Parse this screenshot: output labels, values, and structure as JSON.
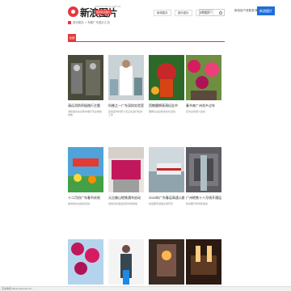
{
  "header": {
    "logo_text": "新浪图片",
    "logo_sub": "PHOTO.SINA.COM.CN",
    "logo_badge": "国家新闻图片"
  },
  "nav": [
    "新闻图片",
    "娱乐图片",
    "体育图片"
  ],
  "search": {
    "placeholder": "搜索图片"
  },
  "login": {
    "text": "新浪用户请登录/体验",
    "button": "新浪图片"
  },
  "breadcrumb": {
    "home": "首页",
    "path": "首页图片 > 专题广东图片汇总"
  },
  "tabs": {
    "active": "全部"
  },
  "cards": [
    {
      "title": "清远消防积极践行主题",
      "desc": "消防官兵在演练中展示专业救援技能"
    },
    {
      "title": "科普之一广东深圳实验室",
      "desc": "实验室内科研人员正在进行检测工作"
    },
    {
      "title": "西樵醒狮表演纪念节",
      "desc": "醒狮表演迎新春文化活动"
    },
    {
      "title": "春节来广州花乡过年",
      "desc": "花市迎春游人如织"
    },
    {
      "title": "十二月份广东春节庆祝",
      "desc": "各地举办迎新春活动"
    },
    {
      "title": "元旦佛山地铁通车启动",
      "desc": "地铁列车首发运营市民体验"
    },
    {
      "title": "2023年广东春运高速公路",
      "desc": "春运期间道路交通有序"
    },
    {
      "title": "广州地铁十八号线开通运营",
      "desc": "新线路开通市民乘坐"
    },
    {
      "title": "",
      "desc": ""
    },
    {
      "title": "",
      "desc": ""
    },
    {
      "title": "",
      "desc": ""
    },
    {
      "title": "",
      "desc": ""
    }
  ],
  "status": {
    "text": "正在等待 photo.sina.com.cn..."
  },
  "colors": {
    "accent": "#e4393c",
    "link": "#1e6ed9"
  }
}
